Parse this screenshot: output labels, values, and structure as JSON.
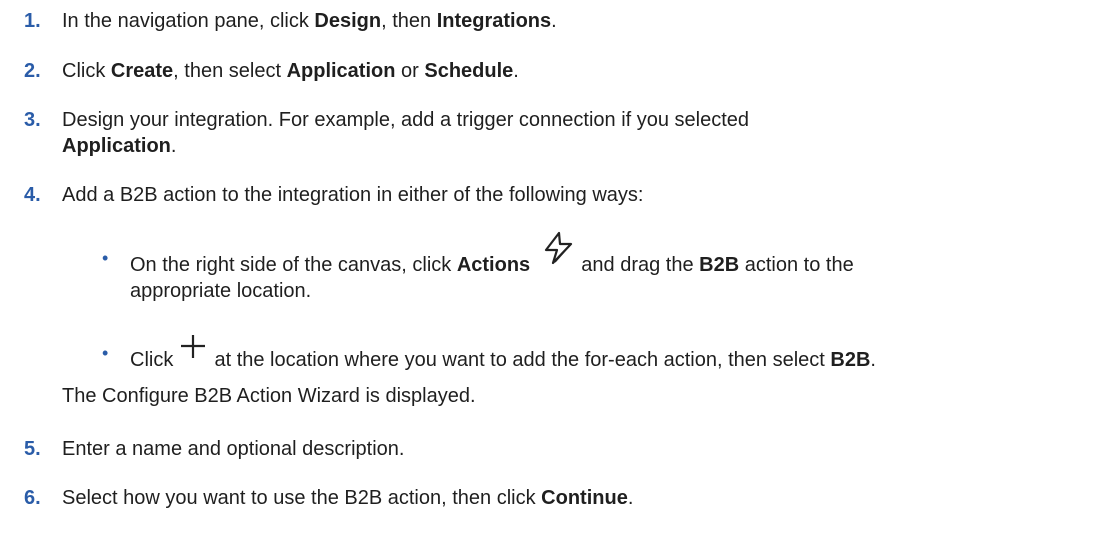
{
  "steps": [
    {
      "num": "1.",
      "parts": [
        "In the navigation pane, click ",
        "Design",
        ", then ",
        "Integrations",
        "."
      ]
    },
    {
      "num": "2.",
      "parts": [
        "Click ",
        "Create",
        ", then select ",
        "Application",
        " or ",
        "Schedule",
        "."
      ]
    },
    {
      "num": "3.",
      "parts": [
        "Design your integration. For example, add a trigger connection if you selected",
        "Application",
        "."
      ]
    },
    {
      "num": "4.",
      "parts": [
        "Add a B2B action to the integration in either of the following ways:"
      ]
    },
    {
      "num": "5.",
      "parts": [
        "Enter a name and optional description."
      ]
    },
    {
      "num": "6.",
      "parts": [
        "Select how you want to use the B2B action, then click ",
        "Continue",
        "."
      ]
    }
  ],
  "bullets": [
    {
      "bullet": "•",
      "parts": [
        "On the right side of the canvas, click ",
        "Actions",
        "and drag the ",
        "B2B",
        " action to the",
        "appropriate location."
      ]
    },
    {
      "bullet": "•",
      "parts": [
        "Click ",
        "at the location where you want to add the for-each action, then select ",
        "B2B",
        "."
      ]
    }
  ],
  "note": "The Configure B2B Action Wizard is displayed.",
  "icons": [
    "actions-lightning-icon",
    "plus-icon"
  ]
}
